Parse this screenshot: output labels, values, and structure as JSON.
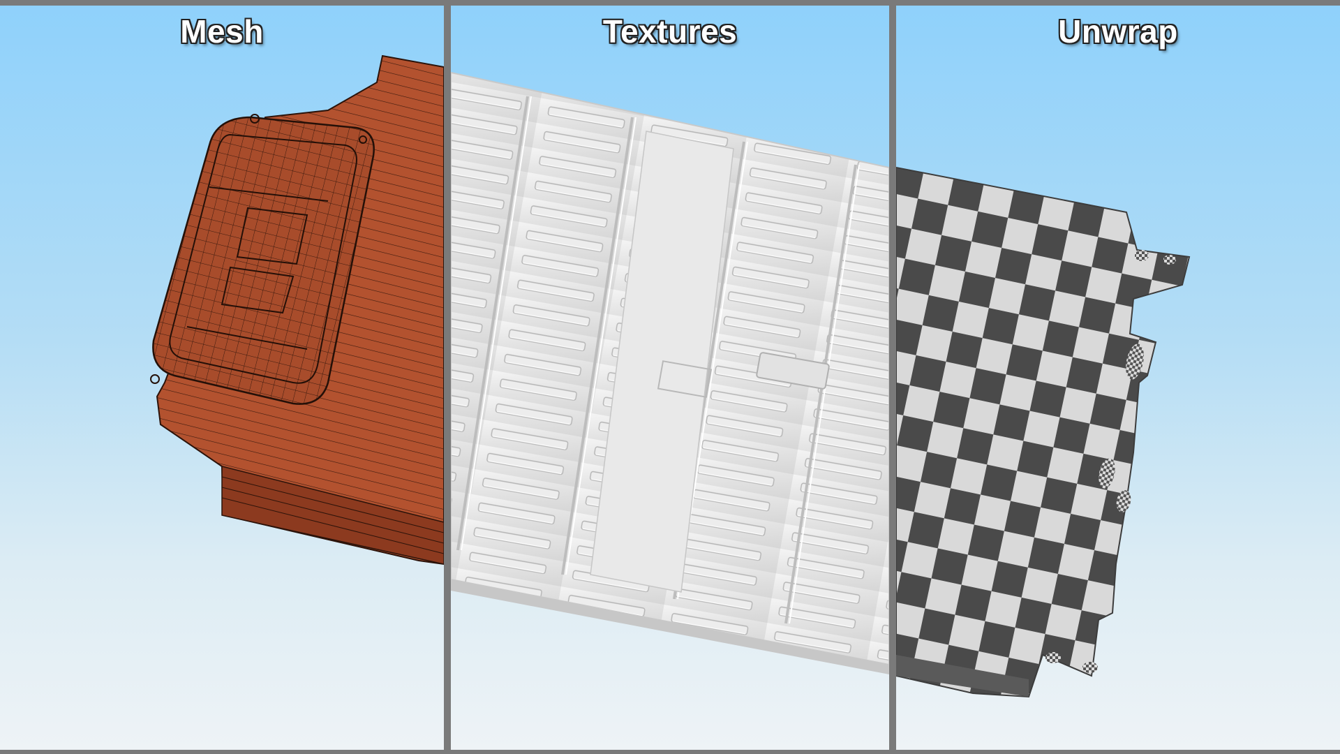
{
  "panels": [
    {
      "title": "Mesh"
    },
    {
      "title": "Textures"
    },
    {
      "title": "Unwrap"
    }
  ]
}
